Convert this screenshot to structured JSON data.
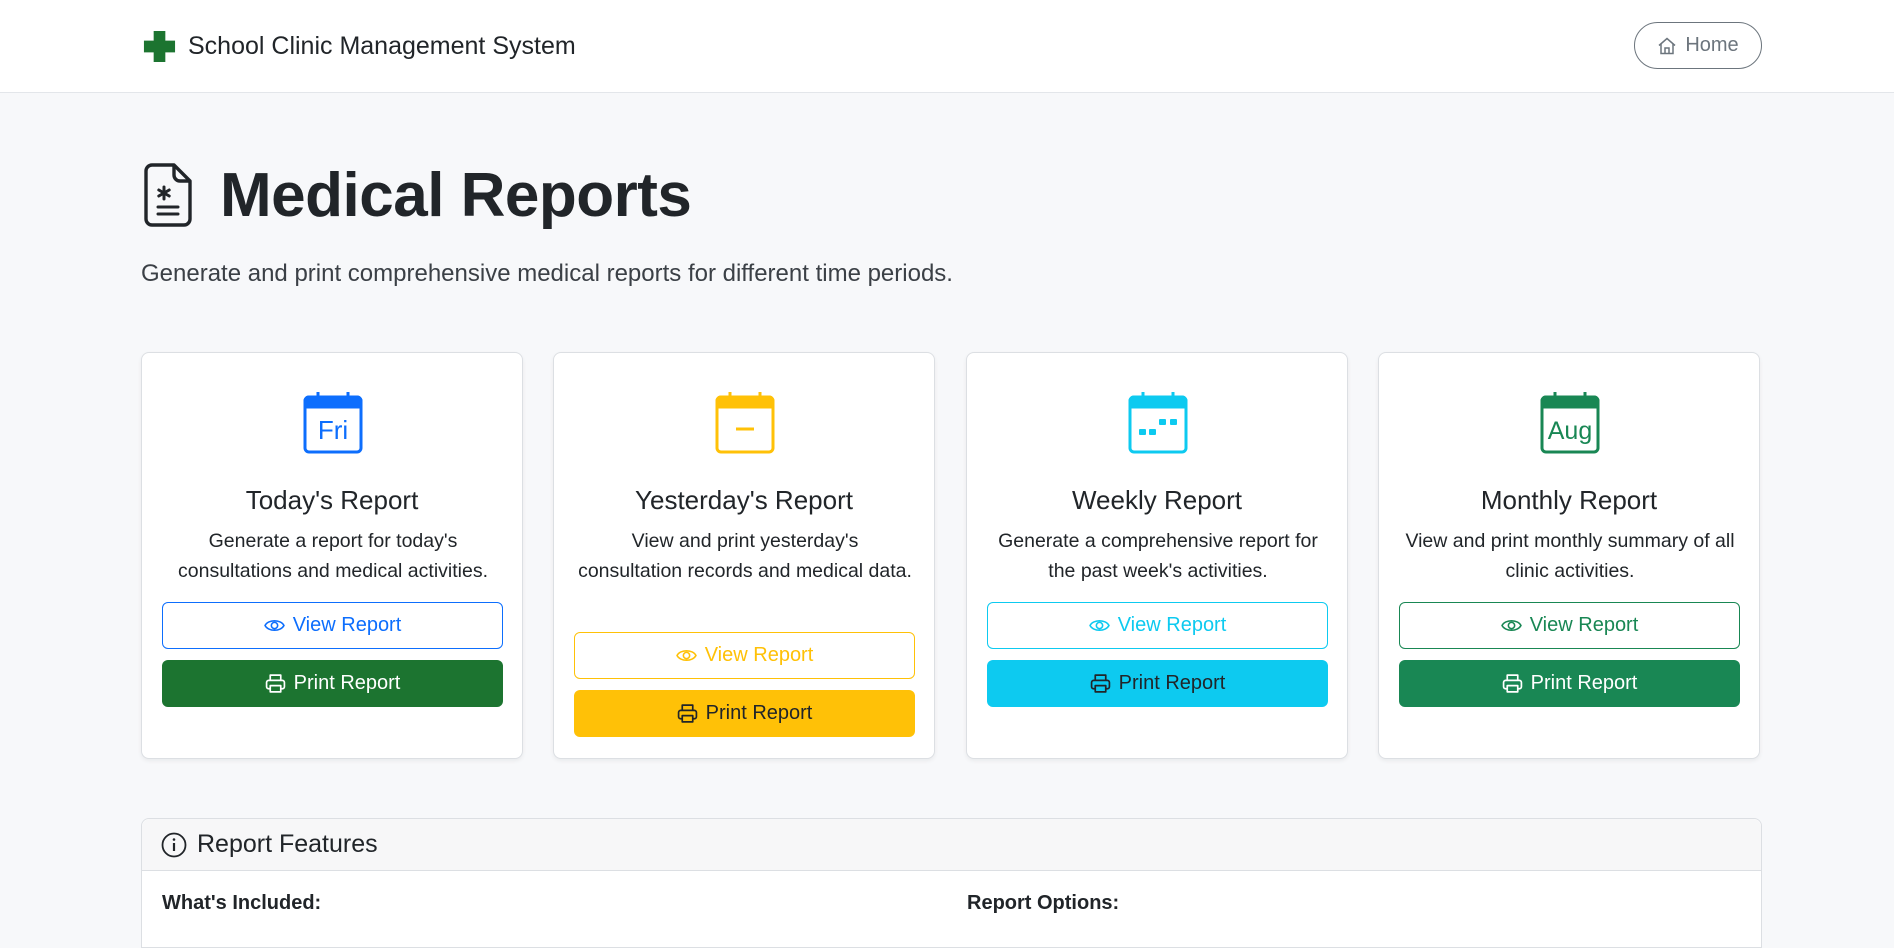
{
  "navbar": {
    "brand": "School Clinic Management System",
    "brand_icon": "medical-cross-icon",
    "home_label": "Home"
  },
  "header": {
    "title": "Medical Reports",
    "lead": "Generate and print comprehensive medical reports for different time periods."
  },
  "cards": [
    {
      "title": "Today's Report",
      "description": "Generate a report for today's consultations and medical activities.",
      "icon_text": "Fri",
      "view_label": "View Report",
      "print_label": "Print Report",
      "color": "#0d6efd",
      "print_bg": "#1c7430"
    },
    {
      "title": "Yesterday's Report",
      "description": "View and print yesterday's consultation records and medical data.",
      "view_label": "View Report",
      "print_label": "Print Report",
      "color": "#ffc107"
    },
    {
      "title": "Weekly Report",
      "description": "Generate a comprehensive report for the past week's activities.",
      "view_label": "View Report",
      "print_label": "Print Report",
      "color": "#0dcaf0"
    },
    {
      "title": "Monthly Report",
      "description": "View and print monthly summary of all clinic activities.",
      "icon_text": "Aug",
      "view_label": "View Report",
      "print_label": "Print Report",
      "color": "#198754"
    }
  ],
  "features": {
    "title": "Report Features",
    "included_heading": "What's Included:",
    "options_heading": "Report Options:"
  }
}
